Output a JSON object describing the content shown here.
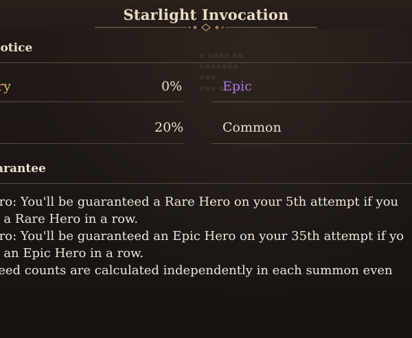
{
  "header": {
    "title": "Starlight Invocation"
  },
  "notice": {
    "label": "lotice",
    "rows": [
      {
        "left_grade": "ry",
        "left_rate": "0%",
        "right_grade": "Epic"
      },
      {
        "left_grade": "",
        "left_rate": "20%",
        "right_grade": "Common"
      }
    ]
  },
  "guarantee": {
    "label": "arantee",
    "lines": [
      "ero: You'll be guaranteed a Rare Hero on your 5th attempt if you",
      "n a Rare Hero in a row.",
      "ero: You'll be guaranteed an Epic Hero on your 35th attempt if yo",
      "n an Epic Hero in a row.",
      "teed counts are calculated independently in each summon even"
    ]
  },
  "colors": {
    "background": "#1f1816",
    "title": "#e9dcc3",
    "legendary_gold": "#e8b960",
    "epic_purple": "#a678e8",
    "text": "#e8e0d4"
  }
}
